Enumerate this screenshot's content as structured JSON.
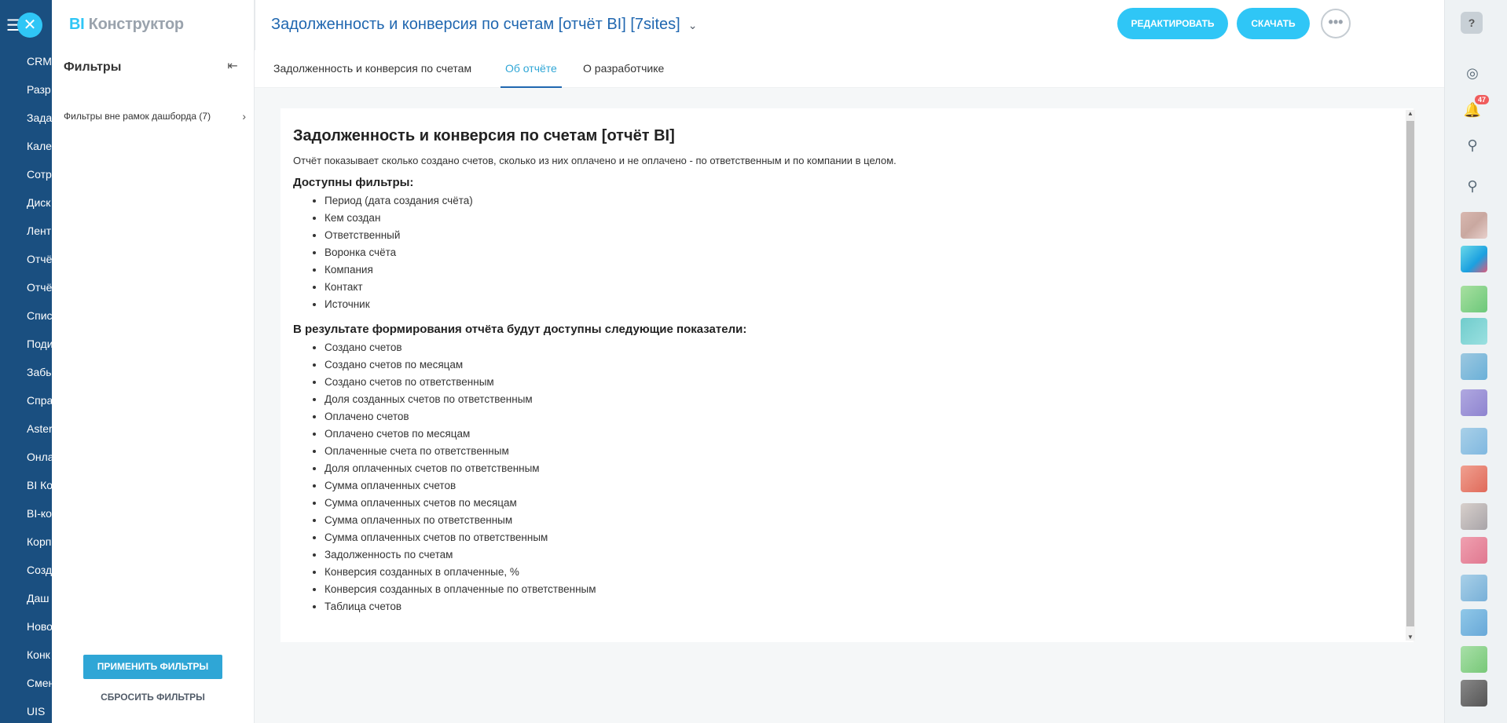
{
  "bg_nav": {
    "items": [
      "CRM",
      "Разр",
      "Зада",
      "Кале",
      "Сотр",
      "Диск",
      "Лент",
      "Отчё",
      "Отчё",
      "Спис",
      "Поди",
      "Забы",
      "Спра",
      "Aster",
      "Онла",
      "BI Ко",
      "BI-ко",
      "Корп",
      "Созд",
      "Даш",
      "Ново",
      "Конк",
      "Смен",
      "UIS"
    ]
  },
  "dock": {
    "help": "?",
    "notifications_count": "47"
  },
  "filter_panel": {
    "logo_bi": "BI",
    "logo_rest": "Конструктор",
    "title": "Фильтры",
    "filter_row": "Фильтры вне рамок дашборда (7)",
    "apply_label": "ПРИМЕНИТЬ ФИЛЬТРЫ",
    "reset_label": "СБРОСИТЬ ФИЛЬТРЫ"
  },
  "header": {
    "report_title": "Задолженность и конверсия по счетам [отчёт BI] [7sites]",
    "edit_label": "РЕДАКТИРОВАТЬ",
    "download_label": "СКАЧАТЬ"
  },
  "tabs": [
    {
      "label": "Задолженность и конверсия по счетам",
      "active": false
    },
    {
      "label": "Об отчёте",
      "active": true
    },
    {
      "label": "О разработчике",
      "active": false
    }
  ],
  "doc": {
    "title": "Задолженность и конверсия по счетам [отчёт BI]",
    "description": "Отчёт показывает сколько создано счетов, сколько из них оплачено и не оплачено - по ответственным и по компании в целом.",
    "filters_heading": "Доступны фильтры:",
    "filters": [
      "Период (дата создания счёта)",
      "Кем создан",
      "Ответственный",
      "Воронка счёта",
      "Компания",
      "Контакт",
      "Источник"
    ],
    "metrics_heading": "В результате формирования отчёта будут доступны следующие показатели:",
    "metrics": [
      "Создано счетов",
      "Создано счетов по месяцам",
      "Создано счетов по ответственным",
      "Доля созданных счетов по ответственным",
      "Оплачено счетов",
      "Оплачено счетов по месяцам",
      "Оплаченные счета по ответственным",
      "Доля оплаченных счетов по ответственным",
      "Сумма оплаченных счетов",
      "Сумма оплаченных счетов по месяцам",
      "Сумма оплаченных по ответственным",
      "Сумма оплаченных счетов по ответственным",
      "Задолженность по счетам",
      "Конверсия созданных в оплаченные, %",
      "Конверсия созданных в оплаченные по ответственным",
      "Таблица счетов"
    ]
  }
}
